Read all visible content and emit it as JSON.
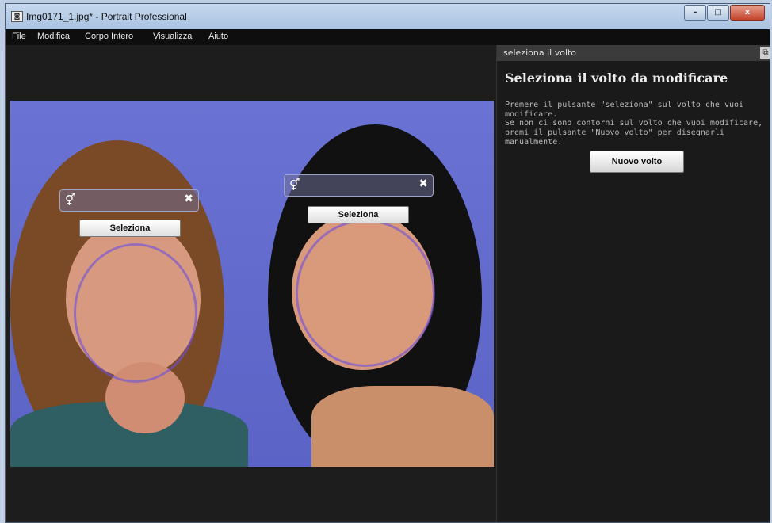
{
  "window": {
    "title": "Img0171_1.jpg* - Portrait Professional",
    "app_icon": "camera-icon",
    "controls": {
      "minimize": "–",
      "maximize": "□",
      "close": "x"
    }
  },
  "menu": [
    "File",
    "Modifica",
    "Corpo Intero",
    "Visualizza",
    "Aiuto"
  ],
  "faces": [
    {
      "gender_symbol": "⚥",
      "close_symbol": "✖",
      "select_label": "Seleziona"
    },
    {
      "gender_symbol": "⚥",
      "close_symbol": "✖",
      "select_label": "Seleziona"
    }
  ],
  "panel": {
    "header": "seleziona il volto",
    "dock_symbol": "⧉",
    "title": "Seleziona il volto da modificare",
    "text1": "Premere il pulsante \"seleziona\" sul volto che vuoi modificare.",
    "text2": "Se non ci sono contorni sul volto che vuoi modificare, premi il pulsante \"Nuovo volto\" per disegnarli manualmente.",
    "new_face_button": "Nuovo volto"
  },
  "colors": {
    "background_blue": "#5b63c6",
    "contour": "#6e50dc",
    "panel_bg": "#1a1a1a"
  }
}
